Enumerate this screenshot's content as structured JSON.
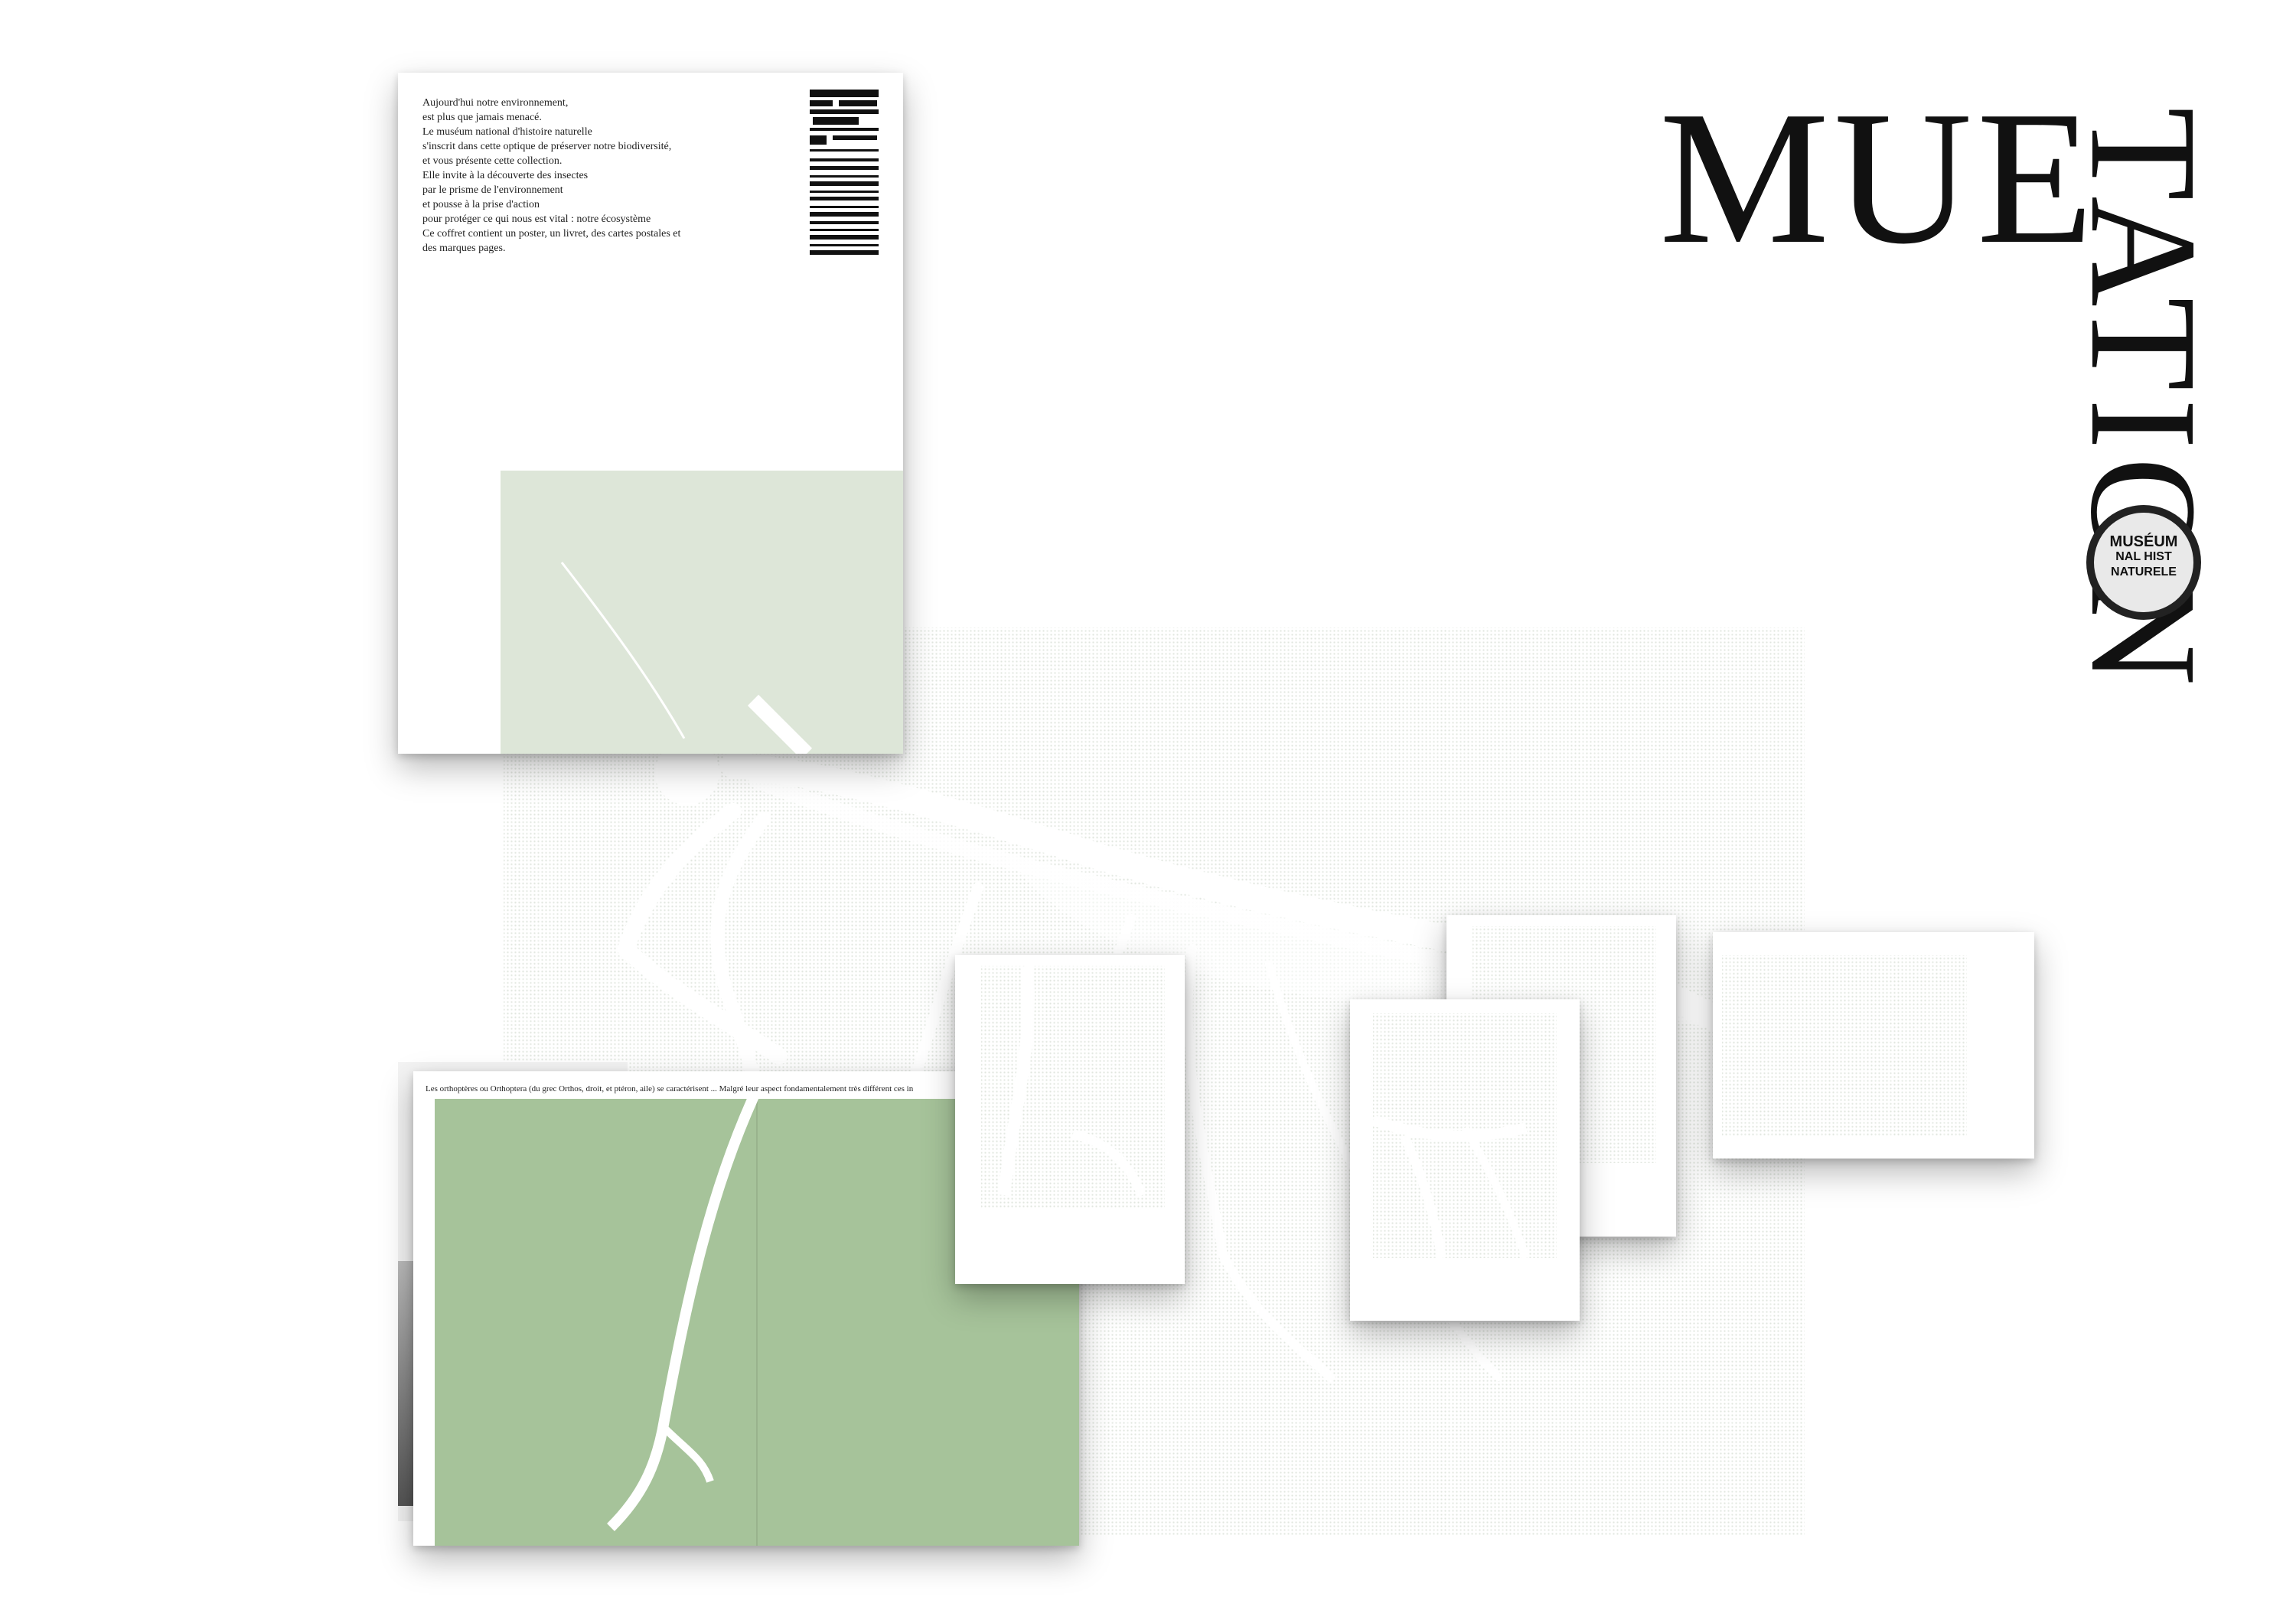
{
  "title": {
    "word1": "MUE",
    "word2_vertical": "TATION"
  },
  "logo": {
    "line1": "MUSÉUM",
    "line2": "NAL HIST",
    "line3": "NATURELE"
  },
  "back_cover": {
    "lines": [
      "Aujourd'hui notre environnement,",
      "est plus que jamais menacé.",
      "Le muséum national d'histoire naturelle",
      "s'inscrit dans cette optique de préserver notre biodiversité,",
      "et vous présente cette collection.",
      "Elle invite à la découverte des insectes",
      "par le prisme de l'environnement",
      "et pousse à la prise d'action",
      "pour protéger ce qui nous est vital : notre écosystème",
      "Ce coffret contient un poster, un livret, des cartes postales et",
      "des marques pages."
    ]
  },
  "booklet": {
    "header_text": "Les orthoptères ou Orthoptera (du grec Orthos, droit, et ptéron, aile) se caractérisent ... Malgré leur aspect fondamentalement très différent ces in"
  },
  "colors": {
    "green_dark": "#9fbd92",
    "green_light": "#eef2ec",
    "ink": "#111111"
  },
  "icons": [
    "mantis-illustration",
    "barcode-icon",
    "museum-seal-logo"
  ]
}
